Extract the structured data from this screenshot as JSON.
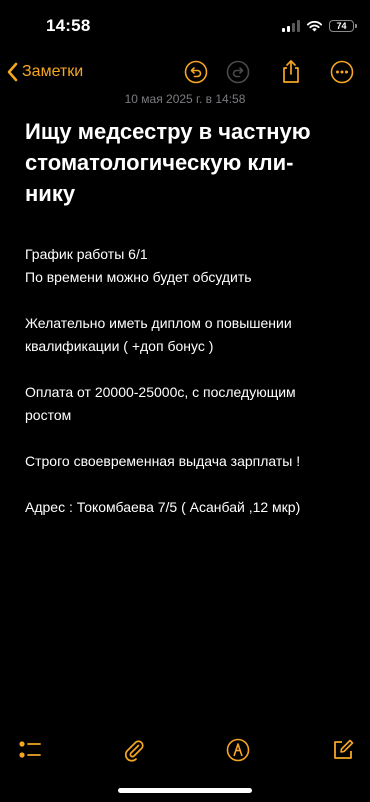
{
  "status_bar": {
    "time": "14:58",
    "battery_level": "74"
  },
  "nav": {
    "back_label": "Заметки",
    "icons": [
      "chevron-left-icon",
      "undo-icon",
      "redo-icon",
      "share-icon",
      "more-icon"
    ]
  },
  "note": {
    "date": "10 мая 2025 г. в 14:58",
    "title_lines": [
      "Ищу медсестру в частную",
      "стоматологическую кли-",
      "нику"
    ],
    "body_lines": [
      "График работы 6/1",
      "По времени можно будет обсудить",
      "",
      "Желательно иметь диплом о повышении",
      "квалификации ( +доп бонус )",
      "",
      "Оплата от 20000-25000с, с последующим",
      "ростом",
      "",
      "Строго своевременная выдача зарплаты !",
      "",
      "Адрес : Токомбаева 7/5 ( Асанбай ,12 мкр)"
    ]
  },
  "toolbar": {
    "icons": [
      "checklist-icon",
      "attachment-icon",
      "markup-pen-icon",
      "compose-icon"
    ]
  },
  "colors": {
    "accent": "#f5a623",
    "background": "#000000",
    "text": "#ffffff",
    "secondary_text": "#7c7c80"
  }
}
